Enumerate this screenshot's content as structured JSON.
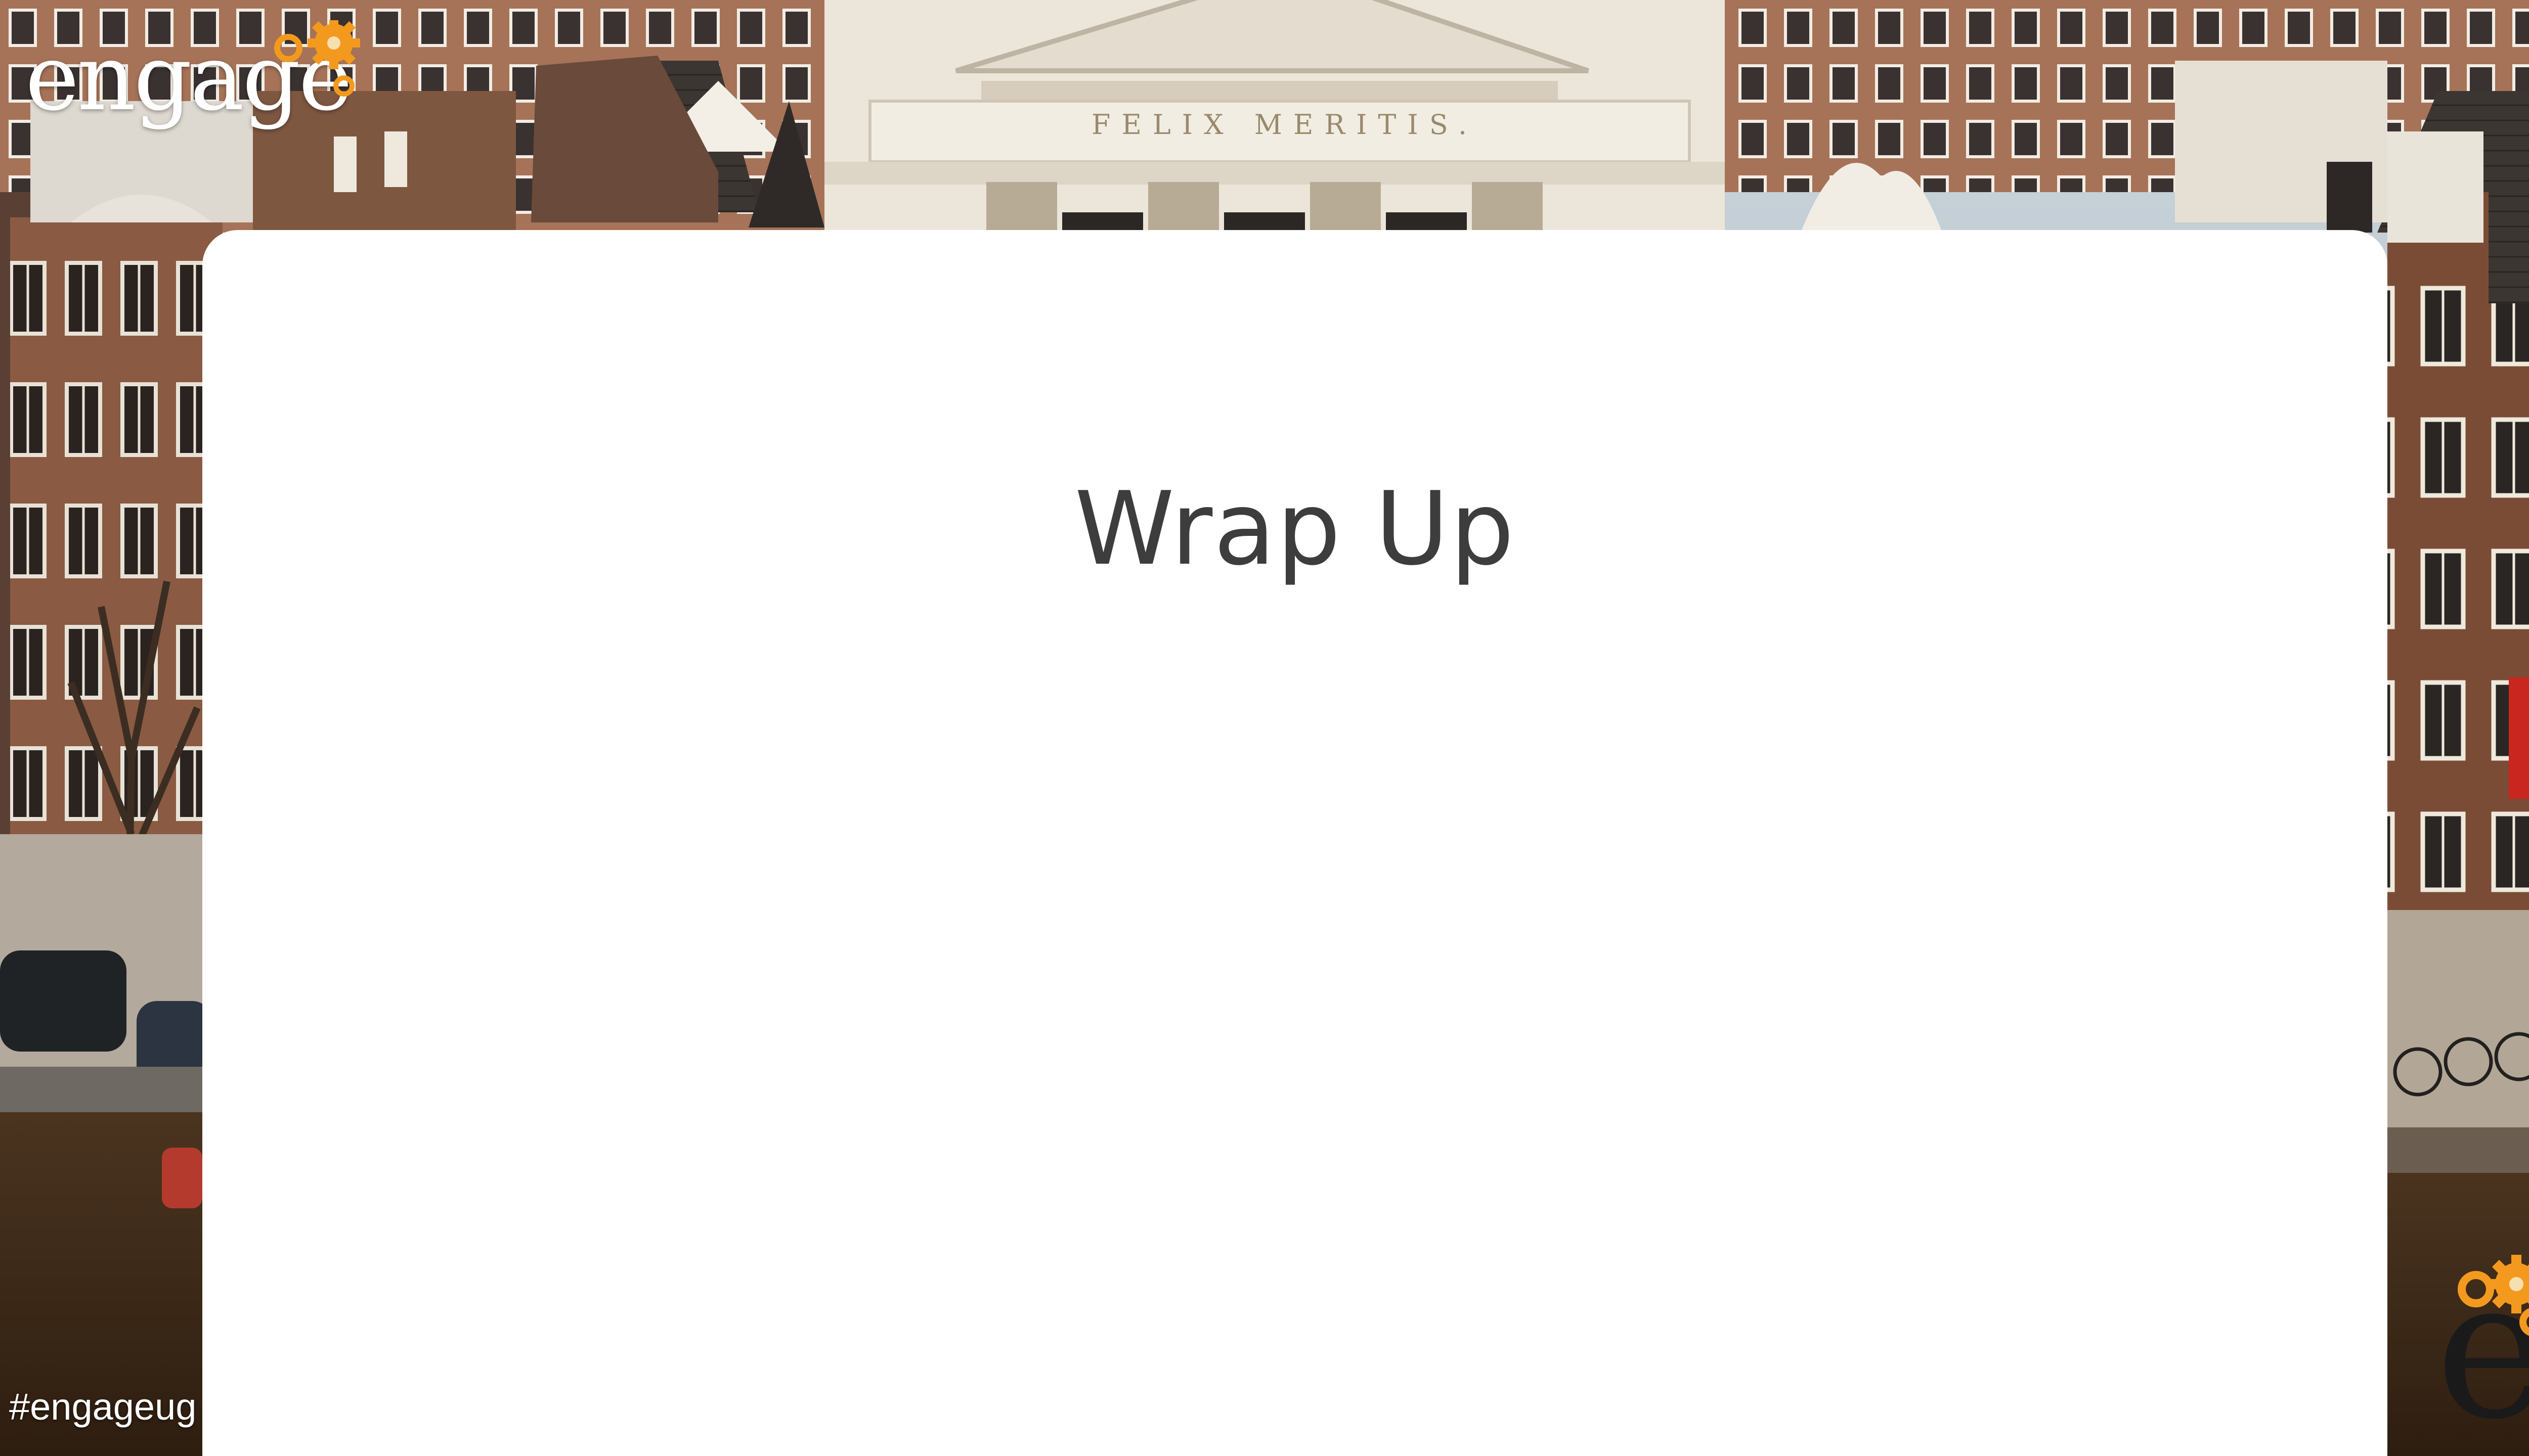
{
  "slide": {
    "title": "Wrap Up"
  },
  "branding": {
    "logo_text": "engage",
    "hashtag": "#engageug",
    "corner_logo_letter": "e",
    "accent_color": "#f39a1e"
  },
  "background": {
    "building_inscription": "FELIX MERITIS."
  }
}
